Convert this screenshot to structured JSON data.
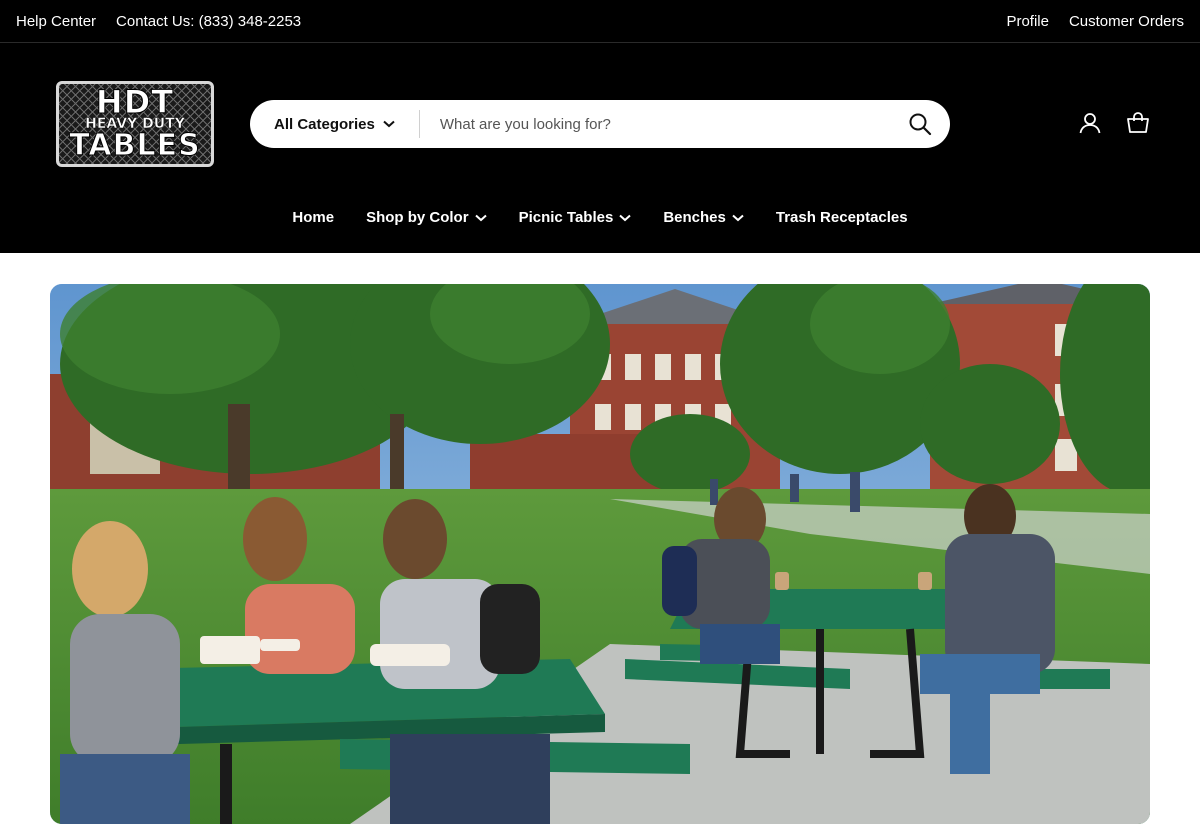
{
  "topbar": {
    "help": "Help Center",
    "contact": "Contact Us: (833) 348-2253",
    "profile": "Profile",
    "orders": "Customer Orders"
  },
  "logo": {
    "line1": "HDT",
    "line2": "HEAVY DUTY",
    "line3": "TABLES"
  },
  "search": {
    "category": "All Categories",
    "placeholder": "What are you looking for?"
  },
  "icons": {
    "account": "user-icon",
    "cart": "shopping-bag-icon",
    "search": "search-icon"
  },
  "nav": {
    "items": [
      {
        "label": "Home",
        "dropdown": false
      },
      {
        "label": "Shop by Color",
        "dropdown": true
      },
      {
        "label": "Picnic Tables",
        "dropdown": true
      },
      {
        "label": "Benches",
        "dropdown": true
      },
      {
        "label": "Trash Receptacles",
        "dropdown": false
      }
    ]
  },
  "colors": {
    "header_bg": "#000000",
    "table_green": "#1f7a55"
  }
}
